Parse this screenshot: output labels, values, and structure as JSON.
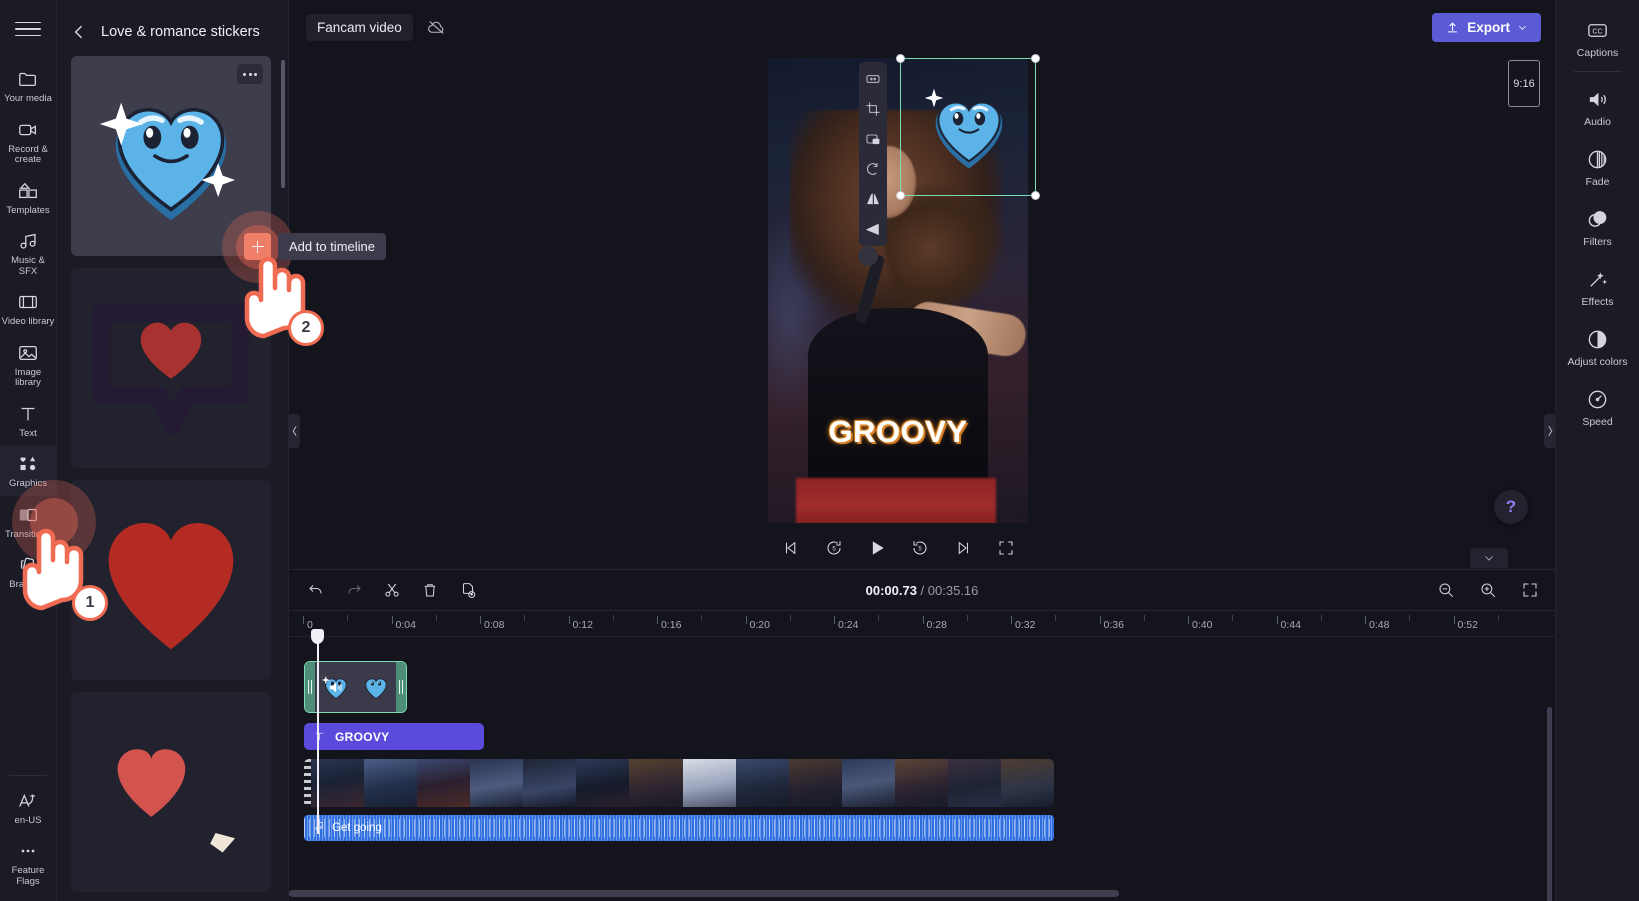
{
  "app": {
    "project_name": "Fancam video",
    "cloud_status_icon": "cloud-off-icon",
    "export_label": "Export",
    "accent_color": "#5b5bd6",
    "selection_color": "#7ddcb4",
    "highlight_color": "#ef6b52"
  },
  "left_rail": {
    "menu_icon": "hamburger-menu-icon",
    "items": [
      {
        "label": "Your media",
        "icon": "folder-icon"
      },
      {
        "label": "Record & create",
        "icon": "camera-icon"
      },
      {
        "label": "Templates",
        "icon": "templates-icon"
      },
      {
        "label": "Music & SFX",
        "icon": "music-note-icon"
      },
      {
        "label": "Video library",
        "icon": "film-strip-icon"
      },
      {
        "label": "Image library",
        "icon": "image-icon"
      },
      {
        "label": "Text",
        "icon": "text-t-icon"
      },
      {
        "label": "Graphics",
        "icon": "shapes-icon"
      },
      {
        "label": "Transitions",
        "icon": "transitions-icon"
      },
      {
        "label": "Brand kit",
        "icon": "brand-kit-icon"
      }
    ],
    "bottom_items": [
      {
        "label": "en-US",
        "icon": "language-icon"
      },
      {
        "label": "Feature Flags",
        "icon": "ellipsis-icon"
      }
    ]
  },
  "panel": {
    "title": "Love & romance stickers",
    "back_icon": "arrow-left-icon",
    "more_icon": "ellipsis-icon",
    "stickers": [
      {
        "name": "blue-smiling-heart-sticker"
      },
      {
        "name": "dark-speech-bubble-heart-sticker"
      },
      {
        "name": "red-brush-heart-sticker"
      },
      {
        "name": "pink-heart-sticker"
      }
    ]
  },
  "preview": {
    "aspect_ratio": "9:16",
    "caption_text": "GROOVY",
    "overlay_sticker": "blue-smiling-heart-sticker",
    "float_tools": [
      {
        "name": "fit-to-width-icon"
      },
      {
        "name": "crop-icon"
      },
      {
        "name": "picture-in-picture-icon"
      },
      {
        "name": "rotate-icon"
      },
      {
        "name": "flip-horizontal-icon"
      },
      {
        "name": "skew-icon"
      }
    ],
    "player_controls": [
      {
        "name": "skip-to-start-icon"
      },
      {
        "name": "rewind-5s-icon"
      },
      {
        "name": "play-icon"
      },
      {
        "name": "forward-5s-icon"
      },
      {
        "name": "skip-to-end-icon"
      },
      {
        "name": "fullscreen-icon"
      }
    ],
    "help_label": "?"
  },
  "right_rail": {
    "items": [
      {
        "label": "Captions",
        "icon": "closed-captions-icon"
      },
      {
        "label": "Audio",
        "icon": "speaker-icon"
      },
      {
        "label": "Fade",
        "icon": "fade-icon"
      },
      {
        "label": "Filters",
        "icon": "filters-icon"
      },
      {
        "label": "Effects",
        "icon": "magic-wand-icon"
      },
      {
        "label": "Adjust colors",
        "icon": "contrast-icon"
      },
      {
        "label": "Speed",
        "icon": "speedometer-icon"
      }
    ]
  },
  "timeline": {
    "toolbar": [
      {
        "name": "undo-button",
        "icon": "undo-icon"
      },
      {
        "name": "redo-button",
        "icon": "redo-icon"
      },
      {
        "name": "split-button",
        "icon": "scissors-icon"
      },
      {
        "name": "delete-button",
        "icon": "trash-icon"
      },
      {
        "name": "duplicate-button",
        "icon": "duplicate-icon"
      }
    ],
    "current_time": "00:00.73",
    "total_time": "00:35.16",
    "time_separator": " / ",
    "zoom_controls": [
      {
        "name": "zoom-out-button",
        "icon": "zoom-out-icon"
      },
      {
        "name": "zoom-in-button",
        "icon": "zoom-in-icon"
      },
      {
        "name": "fit-timeline-button",
        "icon": "fit-screen-icon"
      }
    ],
    "ruler_labels": [
      "0",
      "0:04",
      "0:08",
      "0:12",
      "0:16",
      "0:20",
      "0:24",
      "0:28",
      "0:32",
      "0:36",
      "0:40",
      "0:44",
      "0:48",
      "0:52"
    ],
    "clips": {
      "sticker": {
        "name": "blue-heart-sticker-clip",
        "label": ""
      },
      "text": {
        "label": "GROOVY",
        "color": "#5b4bdd",
        "icon": "text-t-icon"
      },
      "video": {
        "name": "fancam-video-clip"
      },
      "audio": {
        "label": "Get going",
        "color": "#2f6fe0",
        "icon": "music-note-icon"
      }
    }
  },
  "walkthrough": {
    "step_one": "1",
    "step_two": "2",
    "tooltip": "Add to timeline"
  }
}
